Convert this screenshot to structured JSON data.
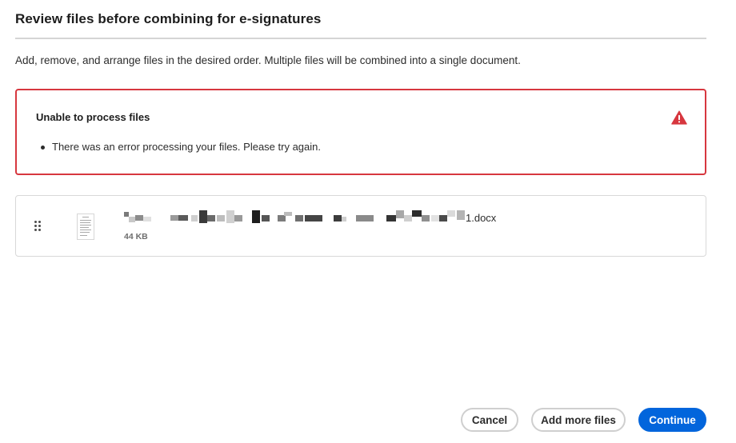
{
  "dialog": {
    "title": "Review files before combining for e-signatures",
    "description": "Add, remove, and arrange files in the desired order. Multiple files will be combined into a single document."
  },
  "error": {
    "title": "Unable to process files",
    "icon": "alert-triangle-icon",
    "color": "#d7373f",
    "messages": [
      "There was an error processing your files. Please try again."
    ]
  },
  "files": [
    {
      "name_suffix": "1.docx",
      "size": "44 KB",
      "icon": "document-thumbnail-icon"
    }
  ],
  "buttons": {
    "cancel": "Cancel",
    "add_more": "Add more files",
    "continue": "Continue"
  },
  "colors": {
    "primary": "#0265dc",
    "error": "#d7373f",
    "border": "#d8d8d8"
  }
}
